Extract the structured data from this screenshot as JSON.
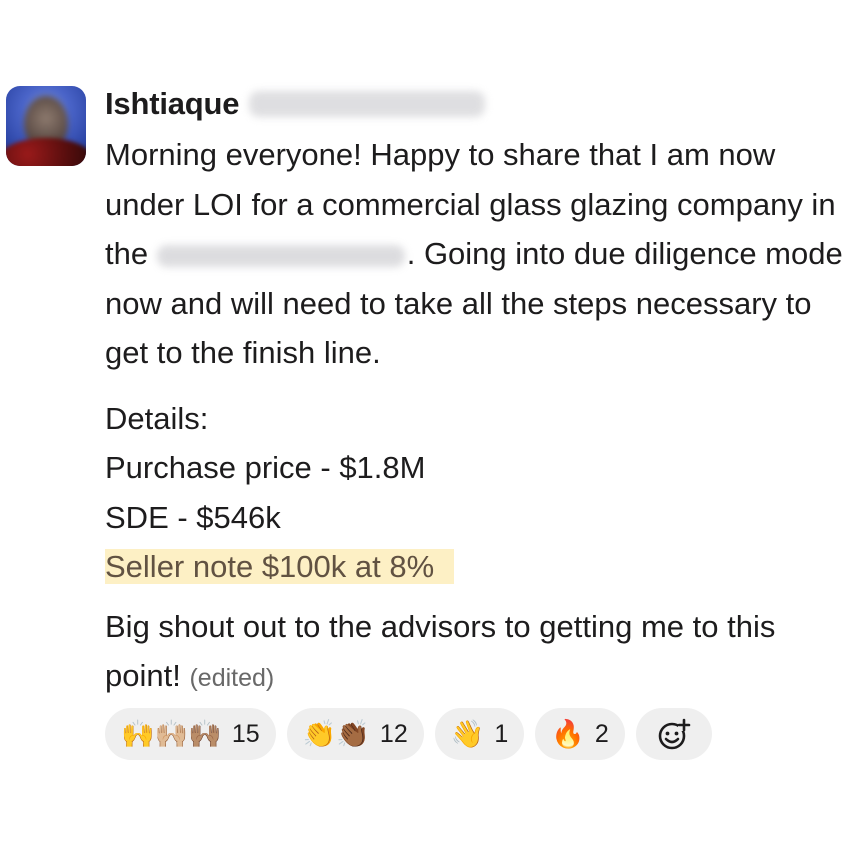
{
  "message": {
    "author": "Ishtiaque",
    "lines": {
      "p1_before": "Morning everyone! Happy to share that I am now under LOI for a commercial glass glazing company in the ",
      "p1_after": ". Going into due diligence mode now and will need to take all the steps necessary to get to the finish line.",
      "details_label": "Details:",
      "purchase_price": "Purchase price - $1.8M",
      "sde": "SDE - $546k",
      "seller_note": "Seller note $100k at 8%",
      "shoutout": "Big shout out to the advisors to getting me to this point!",
      "edited": "(edited)"
    }
  },
  "reactions": [
    {
      "emojis": "🙌🙌🏼🙌🏽",
      "icon": "raised-hands",
      "count": "15"
    },
    {
      "emojis": "👏👏🏾",
      "icon": "clapping-hands",
      "count": "12"
    },
    {
      "emojis": "👋",
      "icon": "waving-hand",
      "count": "1"
    },
    {
      "emojis": "🔥",
      "icon": "fire",
      "count": "2"
    }
  ],
  "add_reaction_icon": "add-reaction-icon",
  "colors": {
    "highlight_bg": "#fdf0c5",
    "highlight_text": "#615242",
    "reaction_bg": "#efefef",
    "edited_text": "#696969"
  }
}
